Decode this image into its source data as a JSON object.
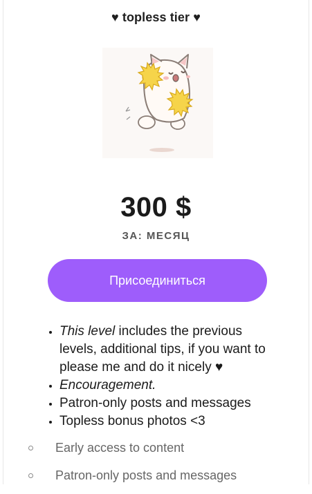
{
  "tier": {
    "title": "♥ topless tier ♥",
    "image": {
      "subject": "cat-cheerleader-with-pompoms"
    },
    "price": "300 $",
    "period": "ЗА: МЕСЯЦ",
    "join_label": "Присоединиться",
    "benefits": [
      {
        "italic": "This level",
        "text": " includes the previous levels, additional tips, if you want to please me and do it nicely ♥"
      },
      {
        "italic": "Encouragement.",
        "text": ""
      },
      {
        "italic": "",
        "text": "Patron-only posts and messages"
      },
      {
        "italic": "",
        "text": "Topless bonus photos <3"
      }
    ],
    "sub_benefits": [
      "Early access to content",
      "Patron-only posts and messages"
    ]
  },
  "colors": {
    "button": "#9e5dfb",
    "button_text": "#ffffff",
    "text": "#1b1b1b",
    "muted": "#666666"
  }
}
